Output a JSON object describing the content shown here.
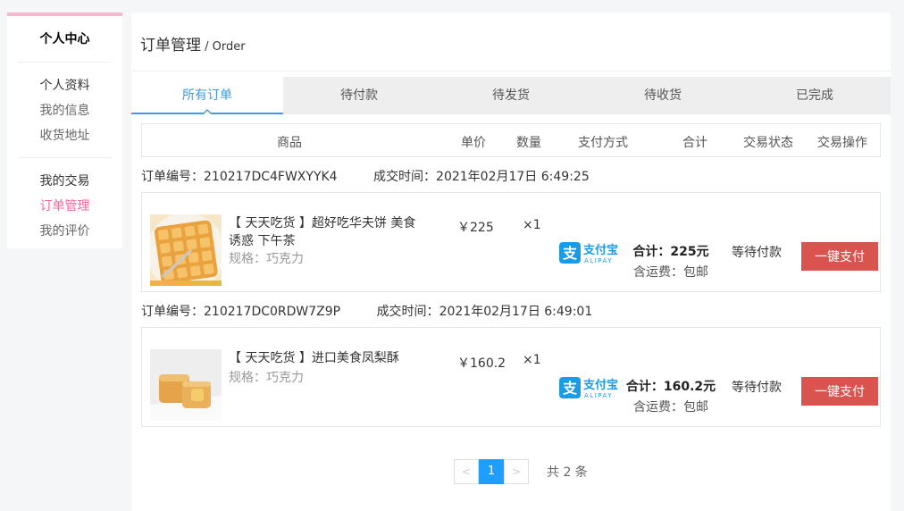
{
  "sidebar": {
    "title": "个人中心",
    "groups": [
      {
        "items": [
          {
            "label": "个人资料"
          },
          {
            "label": "我的信息"
          },
          {
            "label": "收货地址"
          }
        ]
      },
      {
        "items": [
          {
            "label": "我的交易"
          },
          {
            "label": "订单管理"
          },
          {
            "label": "我的评价"
          }
        ]
      }
    ],
    "active_color": "#f4649b"
  },
  "header": {
    "title_zh": "订单管理",
    "title_en": "/ Order"
  },
  "tabs": [
    {
      "label": "所有订单",
      "active": true
    },
    {
      "label": "待付款"
    },
    {
      "label": "待发货"
    },
    {
      "label": "待收货"
    },
    {
      "label": "已完成"
    }
  ],
  "columns": [
    "商品",
    "单价",
    "数量",
    "支付方式",
    "合计",
    "交易状态",
    "交易操作"
  ],
  "orders": [
    {
      "number_label": "订单编号：",
      "number": "210217DC4FWXYYK4",
      "time_label": "成交时间：",
      "time": "2021年02月17日 6:49:25",
      "product_name": "【 天天吃货 】超好吃华夫饼 美食诱惑 下午茶",
      "spec": "规格：巧克力",
      "price": "￥225",
      "qty": "×1",
      "payment_icon": "alipay-logo",
      "total": "合计：225元",
      "shipping": "含运费：包邮",
      "status": "等待付款",
      "action": "一键支付"
    },
    {
      "number_label": "订单编号：",
      "number": "210217DC0RDW7Z9P",
      "time_label": "成交时间：",
      "time": "2021年02月17日 6:49:01",
      "product_name": "【 天天吃货 】进口美食凤梨酥",
      "spec": "规格：巧克力",
      "price": "￥160.2",
      "qty": "×1",
      "payment_icon": "alipay-logo",
      "total": "合计：160.2元",
      "shipping": "含运费：包邮",
      "status": "等待付款",
      "action": "一键支付"
    }
  ],
  "pagination": {
    "prev": "<",
    "current": "1",
    "next": ">",
    "total_text": "共 2 条"
  },
  "colors": {
    "accent": "#3e9cdd",
    "pay_button": "#d9534f",
    "page_active": "#1e9fff",
    "alipay": "#1a9be6"
  }
}
